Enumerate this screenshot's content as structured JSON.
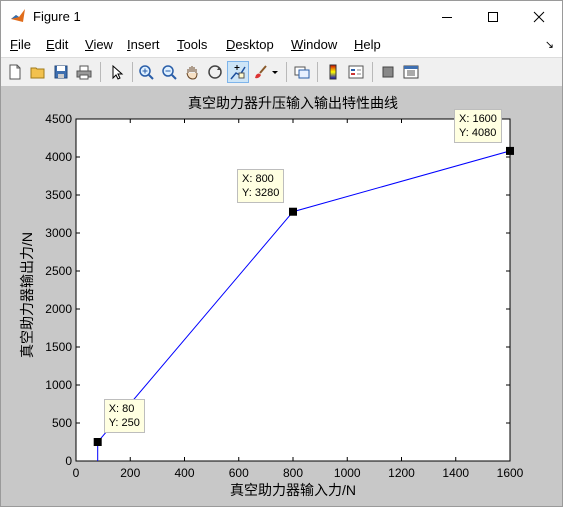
{
  "window": {
    "title": "Figure 1",
    "controls": {
      "minimize": "minimize",
      "maximize": "maximize",
      "close": "close"
    }
  },
  "menu": [
    {
      "label": "File",
      "u": "F",
      "rest": "ile"
    },
    {
      "label": "Edit",
      "u": "E",
      "rest": "dit"
    },
    {
      "label": "View",
      "u": "V",
      "rest": "iew"
    },
    {
      "label": "Insert",
      "u": "I",
      "rest": "nsert"
    },
    {
      "label": "Tools",
      "u": "T",
      "rest": "ools"
    },
    {
      "label": "Desktop",
      "u": "D",
      "rest": "esktop"
    },
    {
      "label": "Window",
      "u": "W",
      "rest": "indow"
    },
    {
      "label": "Help",
      "u": "H",
      "rest": "elp"
    }
  ],
  "toolbar": {
    "items": [
      "new-figure-icon",
      "open-file-icon",
      "save-icon",
      "print-icon",
      "pointer-icon",
      "zoom-in-icon",
      "zoom-out-icon",
      "pan-hand-icon",
      "rotate-3d-icon",
      "data-cursor-icon",
      "brush-icon",
      "link-plot-icon",
      "colorbar-icon",
      "legend-icon",
      "hide-plot-tools-icon",
      "show-plot-tools-icon"
    ],
    "active": "data-cursor-icon"
  },
  "chart_data": {
    "type": "line",
    "title": "真空助力器升压输入输出特性曲线",
    "xlabel": "真空助力器输入力/N",
    "ylabel": "真空助力器输出力/N",
    "xlim": [
      0,
      1600
    ],
    "ylim": [
      0,
      4500
    ],
    "xticks": [
      0,
      200,
      400,
      600,
      800,
      1000,
      1200,
      1400,
      1600
    ],
    "yticks": [
      0,
      500,
      1000,
      1500,
      2000,
      2500,
      3000,
      3500,
      4000,
      4500
    ],
    "series": [
      {
        "x": [
          80,
          80,
          800,
          1600
        ],
        "y": [
          0,
          250,
          3280,
          4080
        ],
        "color": "#0000ff"
      }
    ],
    "datatips": [
      {
        "x": 80,
        "y": 250,
        "line1": "X: 80",
        "line2": "Y: 250"
      },
      {
        "x": 800,
        "y": 3280,
        "line1": "X: 800",
        "line2": "Y: 3280"
      },
      {
        "x": 1600,
        "y": 4080,
        "line1": "X: 1600",
        "line2": "Y: 4080"
      }
    ],
    "grid": false
  }
}
